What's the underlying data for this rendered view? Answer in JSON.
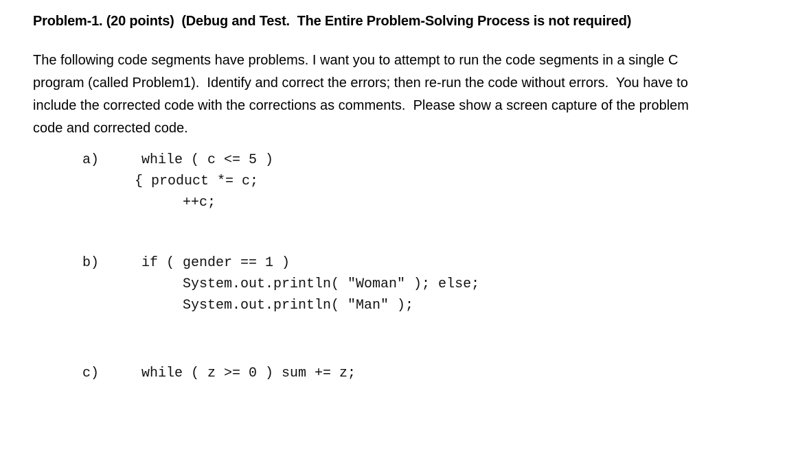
{
  "title": "Problem-1. (20 points)  (Debug and Test.  The Entire Problem-Solving Process is not required)",
  "instructions": [
    "The following code segments have problems. I want you to attempt to run the code segments in a single C",
    "program (called Problem1).  Identify and correct the errors; then re-run the code without errors.  You have to",
    "include the corrected code with the corrections as comments.  Please show a screen capture of the problem",
    "code and corrected code."
  ],
  "parts": [
    {
      "label": "a)",
      "lines": [
        "while ( c <= 5 )",
        "{ product *= c;",
        "++c;"
      ]
    },
    {
      "label": "b)",
      "lines": [
        "if ( gender == 1 )",
        "System.out.println( \"Woman\" ); else;",
        "System.out.println( \"Man\" );"
      ]
    },
    {
      "label": "c)",
      "lines": [
        "while ( z >= 0 ) sum += z;"
      ]
    }
  ]
}
